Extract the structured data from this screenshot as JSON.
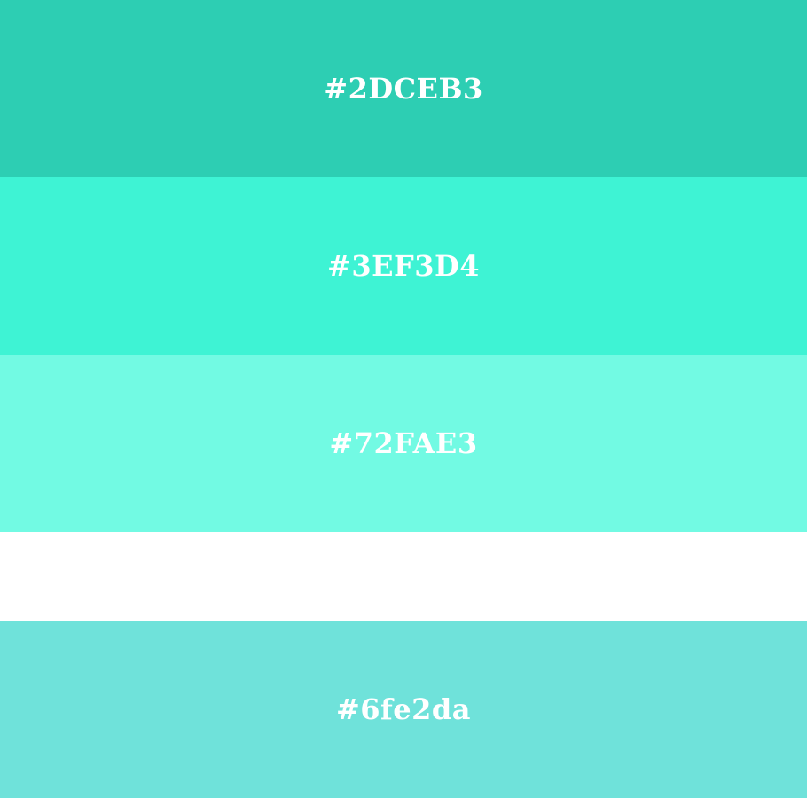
{
  "swatches": [
    {
      "label": "#2DCEB3",
      "color": "#2DCEB3"
    },
    {
      "label": "#3EF3D4",
      "color": "#3EF3D4"
    },
    {
      "label": "#72FAE3",
      "color": "#72FAE3"
    },
    {
      "label": "#6fe2da",
      "color": "#6fe2da"
    }
  ],
  "gap_color": "#ffffff"
}
